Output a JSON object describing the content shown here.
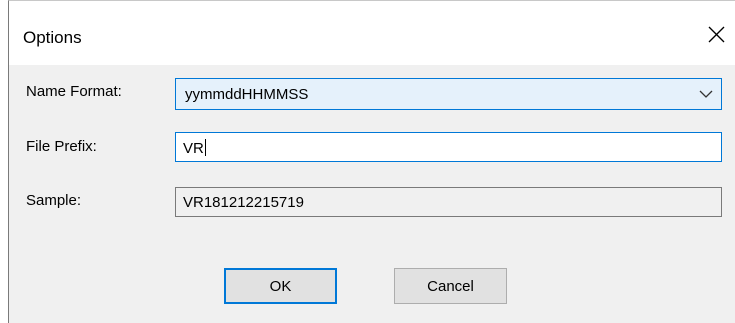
{
  "window": {
    "title": "Options",
    "close_icon": "close-icon"
  },
  "form": {
    "name_format": {
      "label": "Name Format:",
      "value": "yymmddHHMMSS",
      "icon": "chevron-down-icon"
    },
    "file_prefix": {
      "label": "File Prefix:",
      "value": "VR"
    },
    "sample": {
      "label": "Sample:",
      "value": "VR181212215719"
    }
  },
  "buttons": {
    "ok_label": "OK",
    "cancel_label": "Cancel"
  },
  "colors": {
    "accent": "#0078d7",
    "dialog_bg": "#f0f0f0",
    "select_bg": "#e5f1fb"
  }
}
